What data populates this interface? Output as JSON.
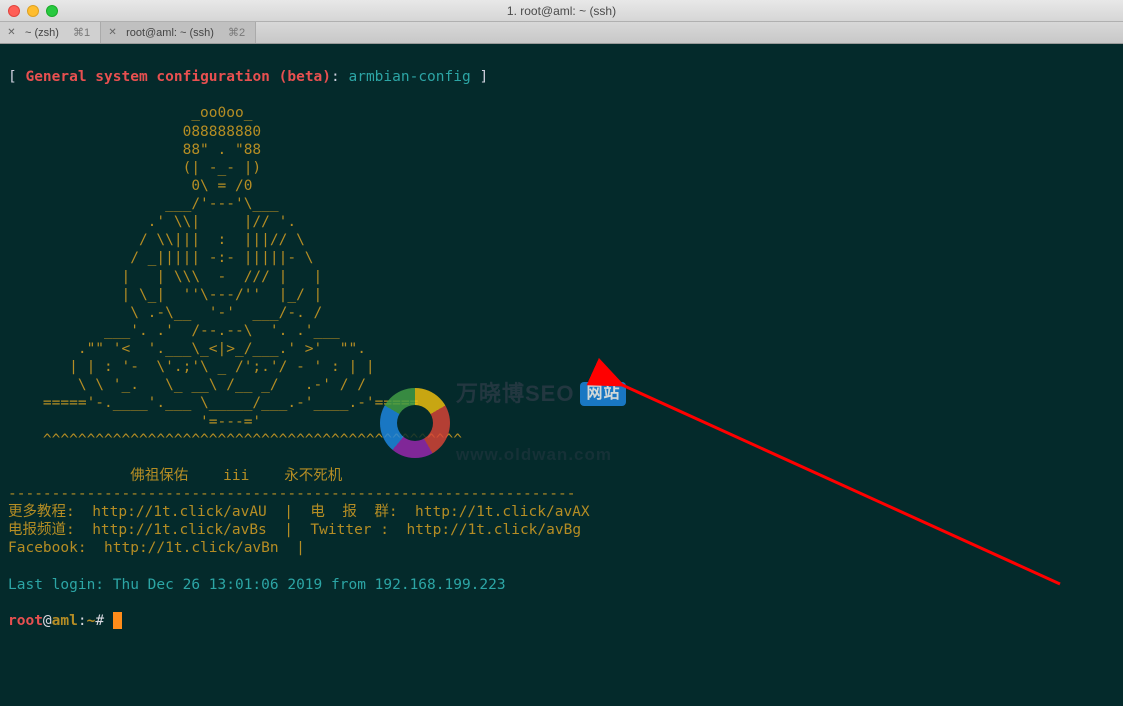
{
  "window": {
    "title": "1. root@aml: ~ (ssh)"
  },
  "tabs": [
    {
      "label": "~ (zsh)",
      "shortcut": "⌘1",
      "active": false
    },
    {
      "label": "root@aml: ~ (ssh)",
      "shortcut": "⌘2",
      "active": true
    }
  ],
  "config_line": {
    "open": "[",
    "red_text": "General system configuration (beta)",
    "sep": ":",
    "cyan_text": "armbian-config",
    "close": "]"
  },
  "ascii_buddha": "                     _oo0oo_\n                    088888880\n                    88\" . \"88\n                    (| -_- |)\n                     0\\ = /0\n                  ___/'---'\\___\n                .' \\\\|     |// '.\n               / \\\\|||  :  |||// \\\n              / _||||| -:- |||||- \\\n             |   | \\\\\\  -  /// |   |\n             | \\_|  ''\\---/''  |_/ |\n              \\ .-\\__  '-'  ___/-. /\n           ___'. .'  /--.--\\  '. .'___\n        .\"\" '<  '.___\\_<|>_/___.' >'  \"\".\n       | | : '-  \\'.;'\\ _ /';.'/ - ' : | |\n        \\ \\ '_.   \\_ __\\ /__ _/   .-' / /\n    ====='-.____'.___ \\_____/___.-'____.-'=====\n                      '=---='\n    ^^^^^^^^^^^^^^^^^^^^^^^^^^^^^^^^^^^^^^^^^^^^^^^^",
  "blessing": "              佛祖保佑    iii    永不死机",
  "separator": "-----------------------------------------------------------------",
  "links": [
    "更多教程:  http://1t.click/avAU  |  电  报  群:  http://1t.click/avAX",
    "电报频道:  http://1t.click/avBs  |  Twitter :  http://1t.click/avBg",
    "Facebook:  http://1t.click/avBn  |"
  ],
  "last_login": "Last login: Thu Dec 26 13:01:06 2019 from 192.168.199.223",
  "prompt": {
    "user": "root",
    "at": "@",
    "host": "aml",
    "colon": ":",
    "path": "~",
    "hash": "#"
  },
  "watermark": {
    "text": "万晓博SEO",
    "badge": "网站",
    "url": "www.oldwan.com"
  }
}
